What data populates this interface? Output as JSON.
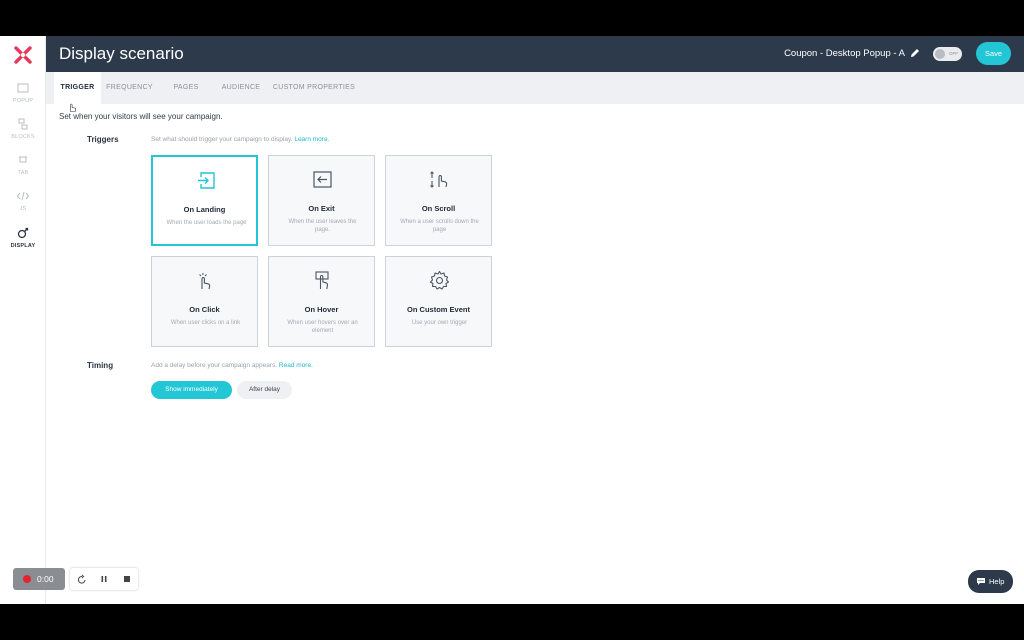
{
  "colors": {
    "accent": "#22c6d4",
    "topbar": "#2d3a4b",
    "logo": "#e8375a"
  },
  "topbar": {
    "title": "Display scenario",
    "campaign_name": "Coupon - Desktop Popup - A",
    "toggle_label": "OFF",
    "save_label": "Save"
  },
  "sidebar": {
    "items": [
      {
        "label": "POPUP",
        "icon": "popup-icon"
      },
      {
        "label": "BLOCKS",
        "icon": "blocks-icon"
      },
      {
        "label": "TAB",
        "icon": "tab-icon"
      },
      {
        "label": "JS",
        "icon": "code-icon"
      },
      {
        "label": "DISPLAY",
        "icon": "display-icon"
      }
    ]
  },
  "tabs": [
    "TRIGGER",
    "FREQUENCY",
    "PAGES",
    "AUDIENCE",
    "CUSTOM PROPERTIES"
  ],
  "intro": "Set when your visitors will see your campaign.",
  "triggers": {
    "label": "Triggers",
    "description": "Set what should trigger your campaign to display.",
    "link": "Learn more.",
    "cards": [
      {
        "name": "On Landing",
        "desc": "When the user loads the page",
        "icon": "enter-icon"
      },
      {
        "name": "On Exit",
        "desc": "When the user leaves the page.",
        "icon": "exit-icon"
      },
      {
        "name": "On Scroll",
        "desc": "When a user scrolls down the page",
        "icon": "scroll-icon"
      },
      {
        "name": "On Click",
        "desc": "When user clicks on a link",
        "icon": "click-icon"
      },
      {
        "name": "On Hover",
        "desc": "When user hovers over an element",
        "icon": "hover-icon"
      },
      {
        "name": "On Custom Event",
        "desc": "Use your own trigger",
        "icon": "gear-icon"
      }
    ]
  },
  "timing": {
    "label": "Timing",
    "description": "Add a delay before your campaign appears.",
    "link": "Read more.",
    "option_immediate": "Show immediately",
    "option_delay": "After delay"
  },
  "recorder": {
    "time": "0:00"
  },
  "help_label": "Help"
}
